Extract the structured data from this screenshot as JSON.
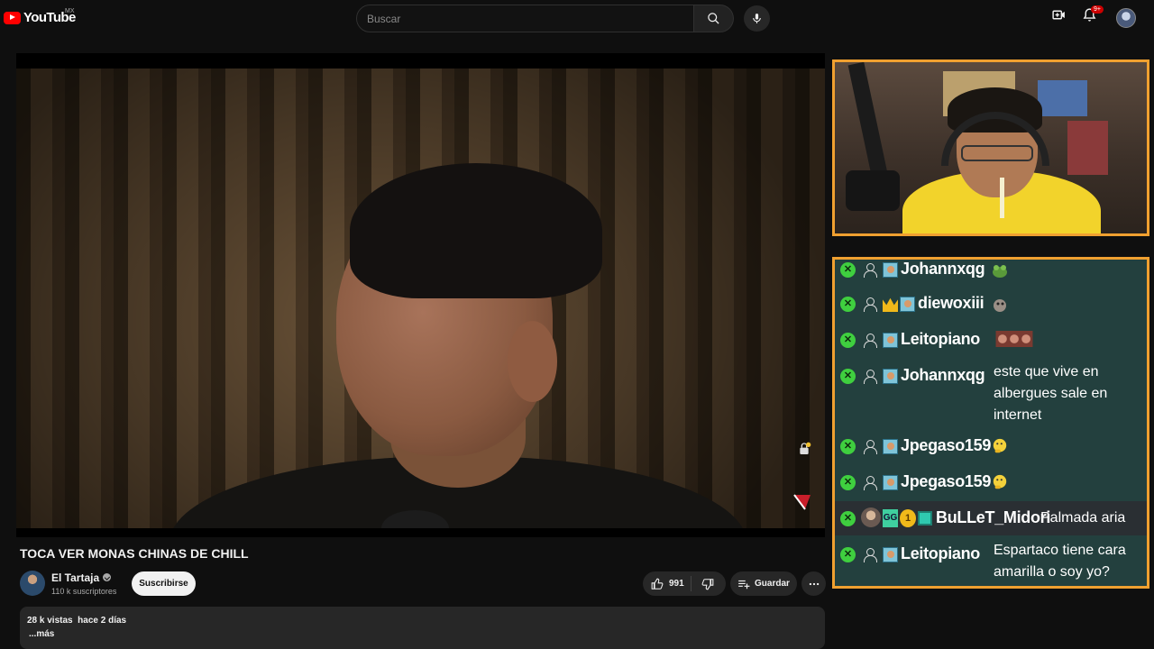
{
  "header": {
    "logo_text": "YouTube",
    "country_code": "MX",
    "search_placeholder": "Buscar",
    "notification_count": "9+"
  },
  "video": {
    "title": "TOCA VER MONAS CHINAS DE CHILL",
    "channel": {
      "name": "El Tartaja",
      "subscribers": "110 k suscriptores"
    },
    "subscribe_label": "Suscribirse",
    "likes": "991",
    "save_label": "Guardar",
    "views": "28 k vistas",
    "age": "hace 2 días",
    "more_label": "...más"
  },
  "chat": {
    "messages": [
      {
        "user": "Johannxqg",
        "text": "",
        "emote": "frog-emote",
        "crown": false
      },
      {
        "user": "diewoxiii",
        "text": "",
        "emote": "dog-emote",
        "crown": true
      },
      {
        "user": "Leitopiano",
        "text": "",
        "emote": "faces-emote",
        "crown": false
      },
      {
        "user": "Johannxqg",
        "text": "este que vive en albergues sale en internet",
        "emote": "",
        "crown": false
      },
      {
        "user": "Jpegaso159",
        "text": "",
        "emote": "thinking-emoji",
        "crown": false
      },
      {
        "user": "Jpegaso159",
        "text": "",
        "emote": "thinking-emoji",
        "crown": false
      },
      {
        "user": "BuLLeT_Midori",
        "text": "Palmada aria",
        "emote": "",
        "crown": false
      },
      {
        "user": "Leitopiano",
        "text": "Espartaco tiene cara amarilla o soy yo?",
        "emote": "",
        "crown": false
      }
    ]
  },
  "colors": {
    "background": "#0f0f0f",
    "accent_red": "#ff0000",
    "overlay_border": "#f0a030",
    "chat_bg": "#23403e",
    "badge_green": "#3fcf3f"
  }
}
